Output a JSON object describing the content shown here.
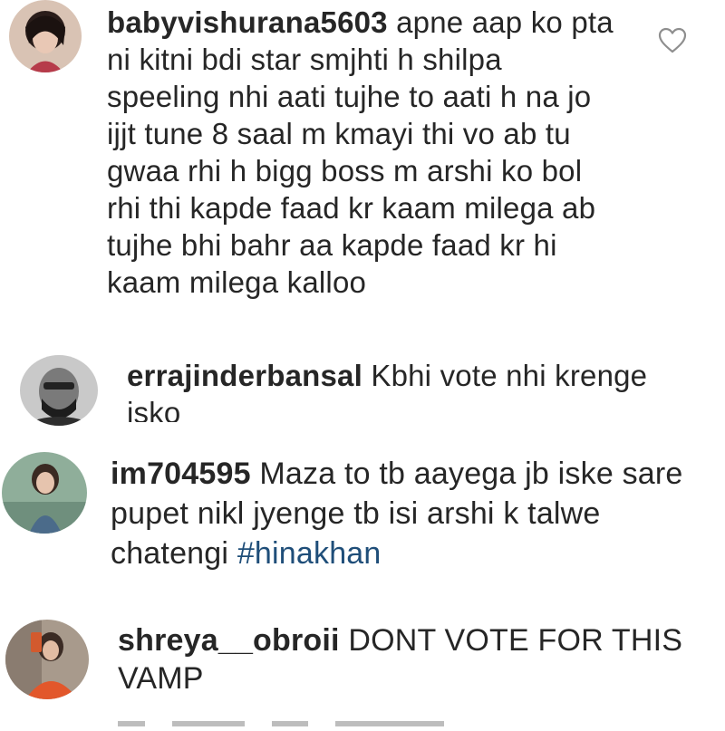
{
  "comments": [
    {
      "username": "babyvishurana5603",
      "text": "apne aap ko pta ni kitni bdi star smjhti h shilpa speeling nhi aati tujhe to aati h na jo ijjt tune 8 saal m kmayi thi vo ab tu gwaa rhi h bigg boss m arshi ko bol rhi thi kapde faad kr kaam milega ab tujhe bhi bahr aa kapde faad kr hi kaam milega kalloo"
    },
    {
      "username": "errajinderbansal",
      "text": "Kbhi vote nhi krenge isko"
    },
    {
      "username": "im704595",
      "text": "Maza to tb aayega jb iske sare pupet nikl jyenge tb isi arshi k talwe chatengi",
      "hashtag": "#hinakhan"
    },
    {
      "username": "shreya__obroii",
      "text": "DONT VOTE FOR THIS VAMP"
    }
  ],
  "colors": {
    "text": "#262626",
    "hashtag": "#1f4e79",
    "background": "#ffffff"
  },
  "icons": {
    "like": "heart-outline-icon"
  }
}
